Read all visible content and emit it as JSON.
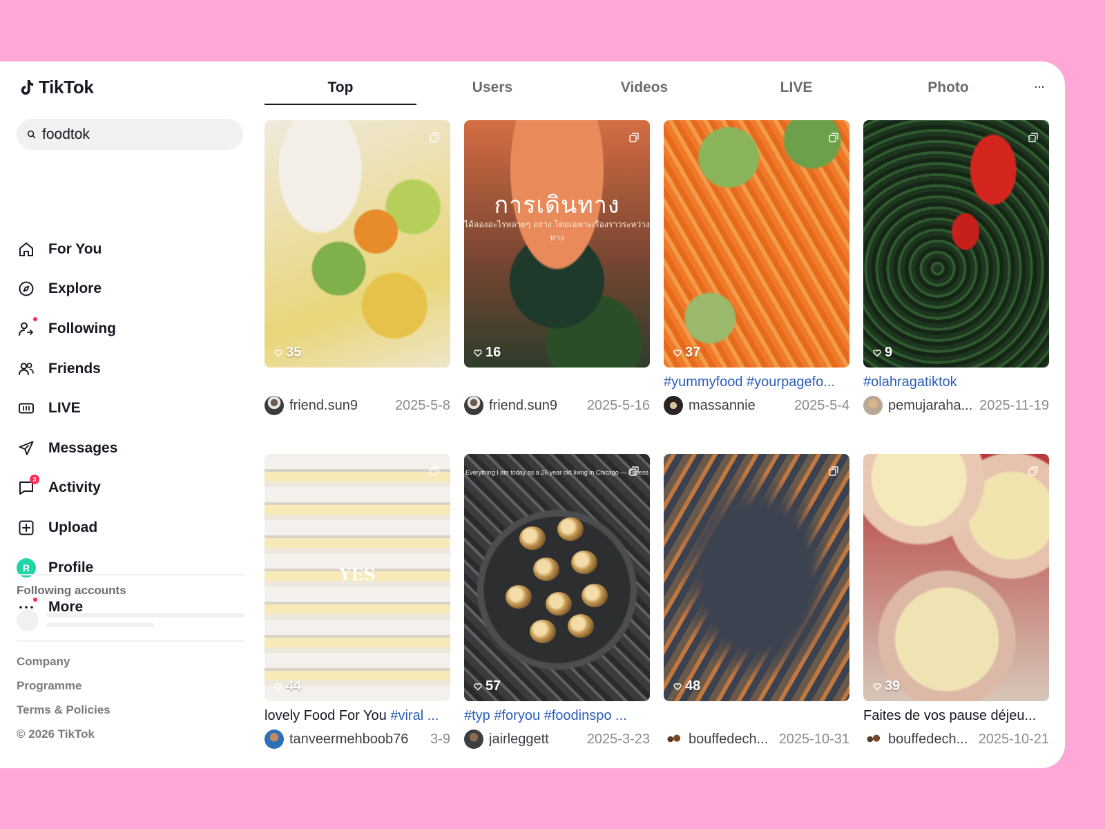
{
  "app": {
    "name": "TikTok"
  },
  "search": {
    "value": "foodtok",
    "icon": "search-icon"
  },
  "nav": [
    {
      "label": "For You",
      "icon": "home-icon"
    },
    {
      "label": "Explore",
      "icon": "compass-icon"
    },
    {
      "label": "Following",
      "icon": "user-follow-icon"
    },
    {
      "label": "Friends",
      "icon": "friends-icon"
    },
    {
      "label": "LIVE",
      "icon": "live-icon"
    },
    {
      "label": "Messages",
      "icon": "send-icon"
    },
    {
      "label": "Activity",
      "icon": "message-bubble-icon",
      "badge": "3"
    },
    {
      "label": "Upload",
      "icon": "upload-icon"
    },
    {
      "label": "Profile",
      "icon": "avatar",
      "avatar_letter": "R"
    },
    {
      "label": "More",
      "icon": "more-icon"
    }
  ],
  "sidebar": {
    "following_title": "Following accounts",
    "footer": [
      "Company",
      "Programme",
      "Terms & Policies",
      "© 2026 TikTok"
    ]
  },
  "tabs": [
    "Top",
    "Users",
    "Videos",
    "LIVE",
    "Photo"
  ],
  "tab_more": "···",
  "results": [
    {
      "likes": "35",
      "caption": "",
      "tags": "",
      "user": "friend.sun9",
      "date": "2025-5-8"
    },
    {
      "likes": "16",
      "caption": "",
      "tags": "",
      "user": "friend.sun9",
      "date": "2025-5-16",
      "overlay_title": "การเดินทาง",
      "overlay_sub": "ได้ลองอะไรหลายๆ อย่าง โดยเฉพาะเรื่องราวระหว่างทาง"
    },
    {
      "likes": "37",
      "caption": "",
      "tags": "#yummyfood #yourpagefo...",
      "user": "massannie",
      "date": "2025-5-4"
    },
    {
      "likes": "9",
      "caption": "",
      "tags": "#olahragatiktok",
      "user": "pemujaraha...",
      "date": "2025-11-19"
    },
    {
      "likes": "44",
      "caption": "lovely Food For You ",
      "tags": "#viral ...",
      "user": "tanveermehboob76",
      "date": "3-9",
      "overlay_title": "YES"
    },
    {
      "likes": "57",
      "caption": "",
      "tags": "#typ #foryou #foodinspo ...",
      "user": "jairleggett",
      "date": "2025-3-23",
      "overlay_sub": "Everything I ate today as a 26 year old living in Chicago — Fitness"
    },
    {
      "likes": "48",
      "caption": "",
      "tags": "",
      "user": "bouffedech...",
      "date": "2025-10-31"
    },
    {
      "likes": "39",
      "caption": "Faites de vos pause déjeu...",
      "tags": "",
      "user": "bouffedech...",
      "date": "2025-10-21"
    }
  ],
  "colors": {
    "background": "#ffa7d6",
    "accent": "#fe2c55",
    "hashtag": "#2b5db8",
    "profile_avatar": "#20d5a8"
  }
}
